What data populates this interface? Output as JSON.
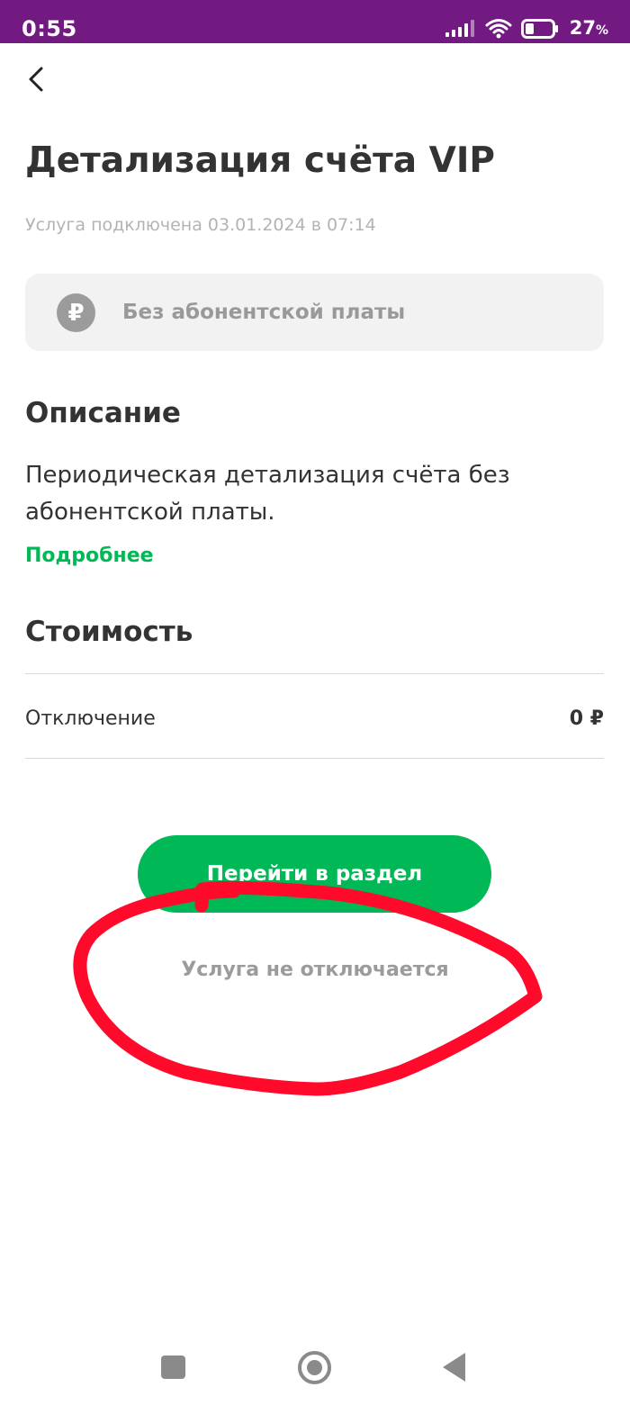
{
  "status_bar": {
    "time": "0:55",
    "battery_percent": "27",
    "percent_sign": "%",
    "background_color": "#731982",
    "icons": [
      "signal-icon",
      "wifi-icon",
      "battery-icon"
    ]
  },
  "header": {
    "back_icon": "chevron-left-icon",
    "title": "Детализация счёта VIP",
    "connected_status": "Услуга подключена 03.01.2024 в 07:14"
  },
  "fee_card": {
    "icon": "ruble-icon",
    "icon_glyph": "₽",
    "label": "Без абонентской платы"
  },
  "description": {
    "title": "Описание",
    "text": "Периодическая детализация счёта без абонентской платы.",
    "more_link": "Подробнее"
  },
  "cost": {
    "title": "Стоимость",
    "rows": [
      {
        "label": "Отключение",
        "value": "0 ₽"
      }
    ]
  },
  "actions": {
    "go_to_section": "Перейти в раздел",
    "notice": "Услуга не отключается"
  },
  "annotation": {
    "color": "#ff0a2a",
    "shape": "hand-drawn circle around notice"
  },
  "nav_bar": {
    "icons": [
      "recent-apps-icon",
      "home-icon",
      "back-triangle-icon"
    ]
  },
  "colors": {
    "accent_green": "#00b956",
    "text_dark": "#333333",
    "text_muted": "#999999",
    "card_background": "#f2f2f2"
  }
}
